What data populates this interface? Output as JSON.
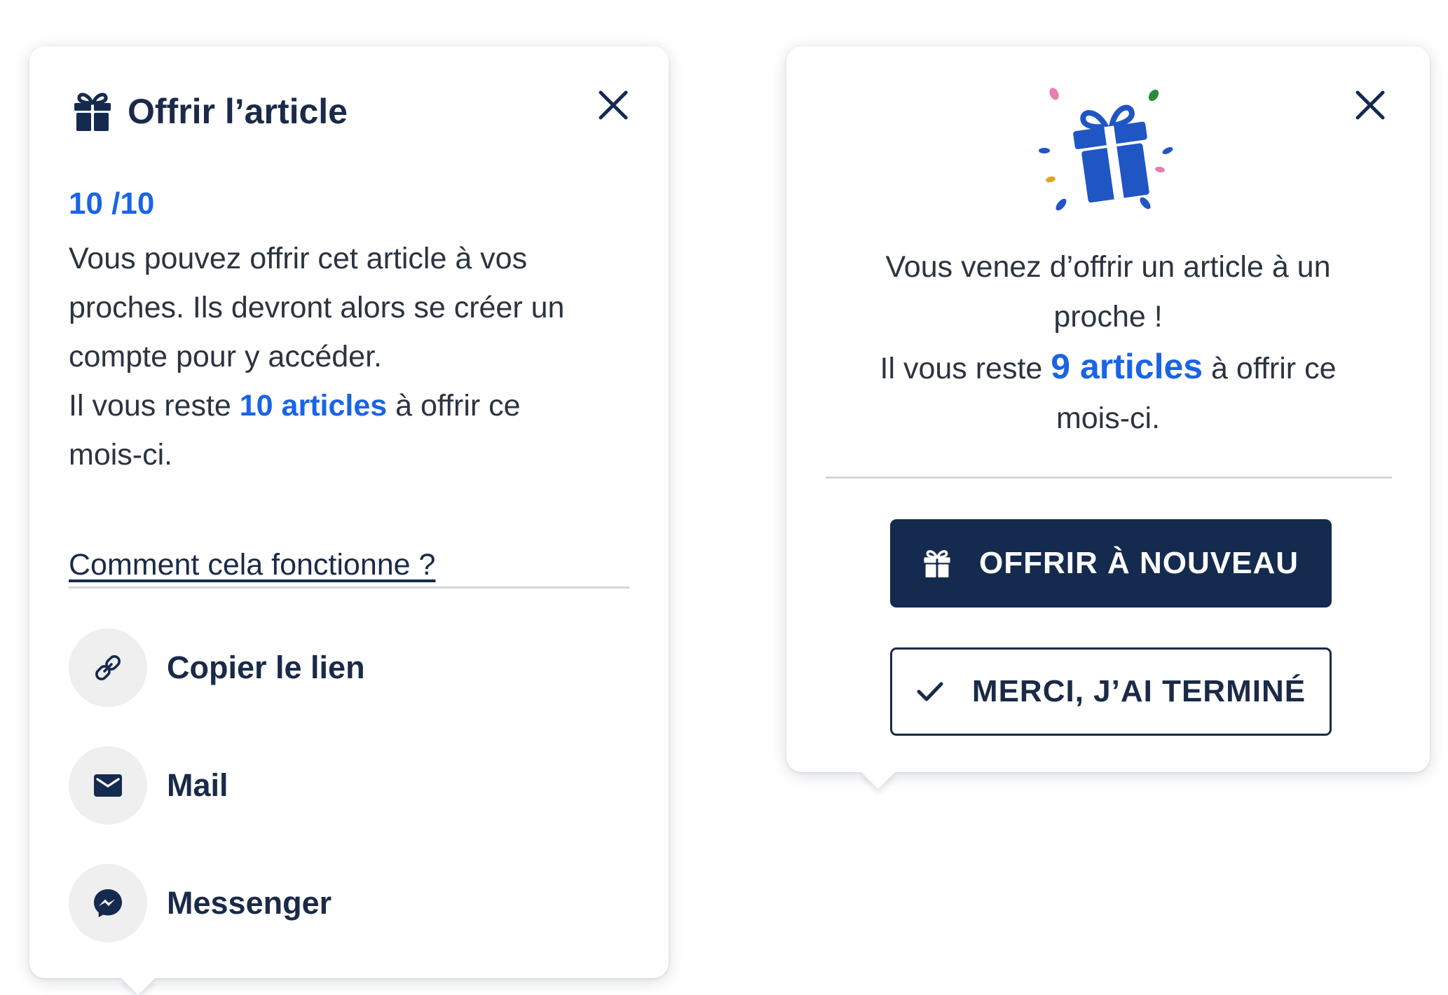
{
  "gift_panel": {
    "title": "Offrir l’article",
    "counter": "10 /10",
    "description_lines": [
      "Vous pouvez offrir cet article à vos",
      "proches. Ils devront alors se créer un",
      "compte pour y accéder."
    ],
    "remaining_prefix": "Il vous reste ",
    "remaining_count": "10 articles",
    "remaining_suffix_1": " à offrir ce",
    "remaining_suffix_2": "mois-ci.",
    "howto_link": "Comment cela fonctionne ?",
    "share_options": [
      {
        "label": "Copier le lien",
        "icon": "link-icon"
      },
      {
        "label": "Mail",
        "icon": "mail-icon"
      },
      {
        "label": "Messenger",
        "icon": "messenger-icon"
      }
    ]
  },
  "confirm_panel": {
    "line_1": "Vous venez d’offrir un article à un",
    "line_2": "proche !",
    "remaining_prefix": "Il vous reste ",
    "remaining_count": "9 articles",
    "remaining_suffix_1": " à offrir ce",
    "remaining_suffix_2": "mois-ci.",
    "offer_again_label": "OFFRIR À NOUVEAU",
    "done_label": "MERCI, J’AI TERMINÉ"
  },
  "colors": {
    "navy": "#152a4f",
    "accent_blue": "#1a64e6",
    "divider": "#d3d6dc",
    "icon_circle": "#efefef"
  }
}
